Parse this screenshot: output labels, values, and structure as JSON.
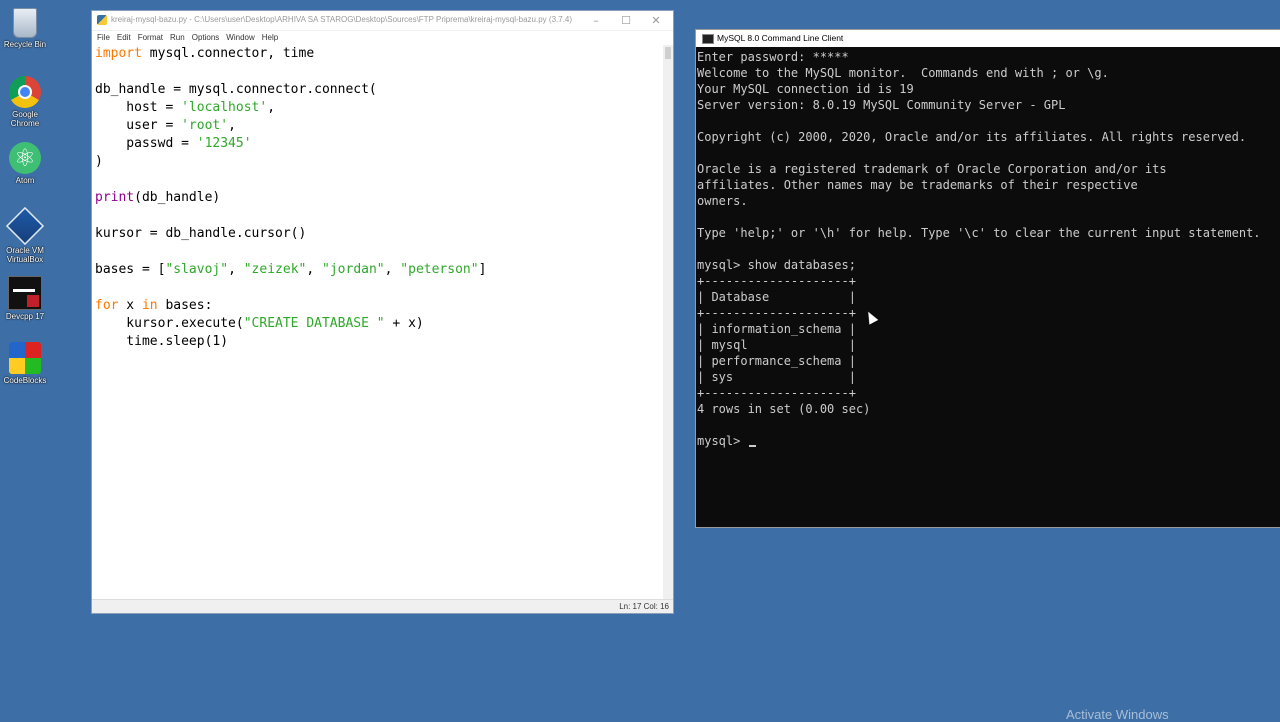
{
  "desktop": {
    "icons": [
      {
        "label": "Recycle Bin",
        "icon": "recycle-bin-icon"
      },
      {
        "label": "Google Chrome",
        "icon": "chrome-icon"
      },
      {
        "label": "Atom",
        "icon": "atom-icon"
      },
      {
        "label": "Oracle VM VirtualBox",
        "icon": "virtualbox-icon"
      },
      {
        "label": "Devcpp 17",
        "icon": "devcpp-icon"
      },
      {
        "label": "CodeBlocks",
        "icon": "codeblocks-icon"
      }
    ],
    "watermark": "Activate Windows"
  },
  "editor": {
    "title": "kreiraj-mysql-bazu.py - C:\\Users\\user\\Desktop\\ARHIVA SA STAROG\\Desktop\\Sources\\FTP Priprema\\kreiraj-mysql-bazu.py (3.7.4)",
    "menu": [
      "File",
      "Edit",
      "Format",
      "Run",
      "Options",
      "Window",
      "Help"
    ],
    "code": {
      "l1_kw": "import",
      "l1_rest": " mysql.connector, time",
      "l3": "db_handle = mysql.connector.connect(",
      "l4_a": "    host = ",
      "l4_s": "'localhost'",
      "l4_b": ",",
      "l5_a": "    user = ",
      "l5_s": "'root'",
      "l5_b": ",",
      "l6_a": "    passwd = ",
      "l6_s": "'12345'",
      "l7": ")",
      "l9_bi": "print",
      "l9_rest": "(db_handle)",
      "l11": "kursor = db_handle.cursor()",
      "l13_a": "bases = [",
      "l13_s1": "\"slavoj\"",
      "l13_c1": ", ",
      "l13_s2": "\"zeizek\"",
      "l13_c2": ", ",
      "l13_s3": "\"jordan\"",
      "l13_c3": ", ",
      "l13_s4": "\"peterson\"",
      "l13_b": "]",
      "l15_kw1": "for",
      "l15_a": " x ",
      "l15_kw2": "in",
      "l15_b": " bases:",
      "l16_a": "    kursor.execute(",
      "l16_s": "\"CREATE DATABASE \"",
      "l16_b": " + x)",
      "l17": "    time.sleep(1)"
    },
    "status": "Ln: 17   Col: 16"
  },
  "console": {
    "title": "MySQL 8.0 Command Line Client",
    "lines": [
      "Enter password: *****",
      "Welcome to the MySQL monitor.  Commands end with ; or \\g.",
      "Your MySQL connection id is 19",
      "Server version: 8.0.19 MySQL Community Server - GPL",
      "",
      "Copyright (c) 2000, 2020, Oracle and/or its affiliates. All rights reserved.",
      "",
      "Oracle is a registered trademark of Oracle Corporation and/or its",
      "affiliates. Other names may be trademarks of their respective",
      "owners.",
      "",
      "Type 'help;' or '\\h' for help. Type '\\c' to clear the current input statement.",
      "",
      "mysql> show databases;",
      "+--------------------+",
      "| Database           |",
      "+--------------------+",
      "| information_schema |",
      "| mysql              |",
      "| performance_schema |",
      "| sys                |",
      "+--------------------+",
      "4 rows in set (0.00 sec)",
      ""
    ],
    "prompt": "mysql> "
  }
}
